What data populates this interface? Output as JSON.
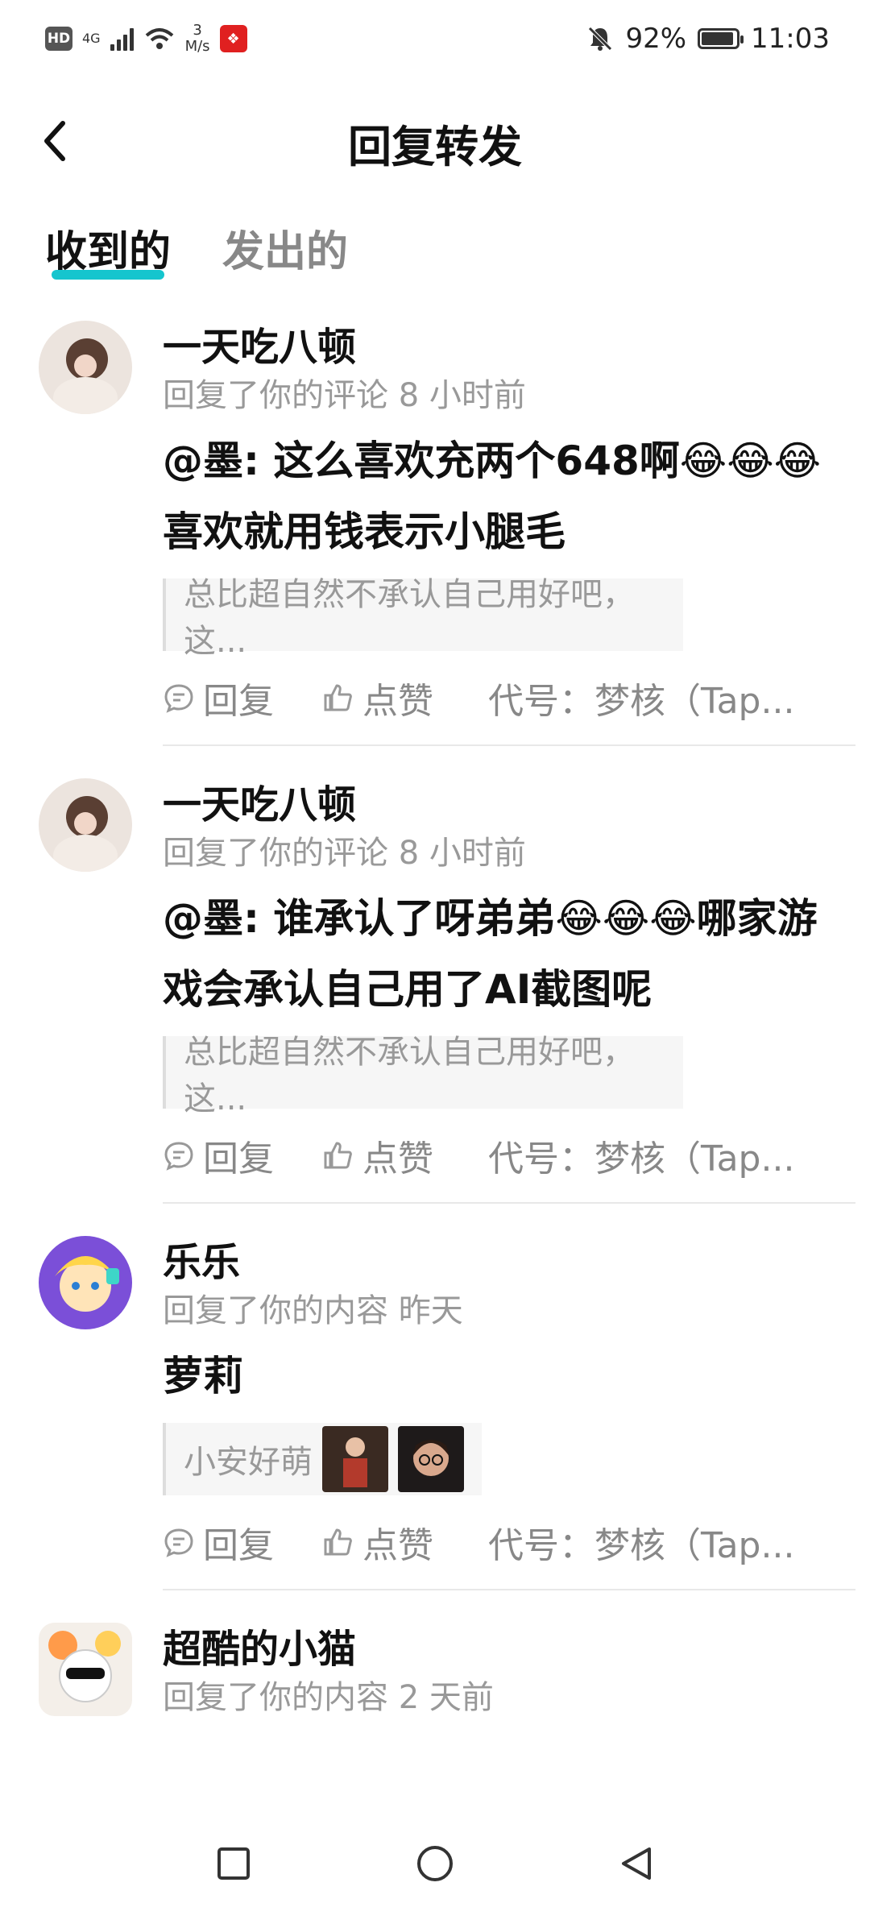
{
  "status": {
    "hd": "HD",
    "signal_type": "4G",
    "net_speed_value": "3",
    "net_speed_unit": "M/s",
    "battery_pct": "92%",
    "battery_level": 0.92,
    "time": "11:03"
  },
  "header": {
    "title": "回复转发"
  },
  "tabs": [
    {
      "label": "收到的",
      "active": true
    },
    {
      "label": "发出的",
      "active": false
    }
  ],
  "accent_color": "#15c5ce",
  "items": [
    {
      "name": "一天吃八顿",
      "meta": "回复了你的评论 8 小时前",
      "text": "@墨: 这么喜欢充两个648啊😂😂😂喜欢就用钱表示小腿毛",
      "quote": "总比超自然不承认自己用好吧，这...",
      "reply": "回复",
      "like": "点赞",
      "tag": "代号：梦核（Tap..."
    },
    {
      "name": "一天吃八顿",
      "meta": "回复了你的评论 8 小时前",
      "text": "@墨: 谁承认了呀弟弟😂😂😂哪家游戏会承认自己用了AI截图呢",
      "quote": "总比超自然不承认自己用好吧，这...",
      "reply": "回复",
      "like": "点赞",
      "tag": "代号：梦核（Tap..."
    },
    {
      "name": "乐乐",
      "meta": "回复了你的内容 昨天",
      "text": "萝莉",
      "quote": "小安好萌",
      "reply": "回复",
      "like": "点赞",
      "tag": "代号：梦核（Tap..."
    },
    {
      "name": "超酷的小猫",
      "meta": "回复了你的内容 2 天前"
    }
  ],
  "icons": [
    "back-arrow-icon",
    "reply-icon",
    "like-icon",
    "home-square-icon",
    "home-circle-icon",
    "back-triangle-icon"
  ]
}
